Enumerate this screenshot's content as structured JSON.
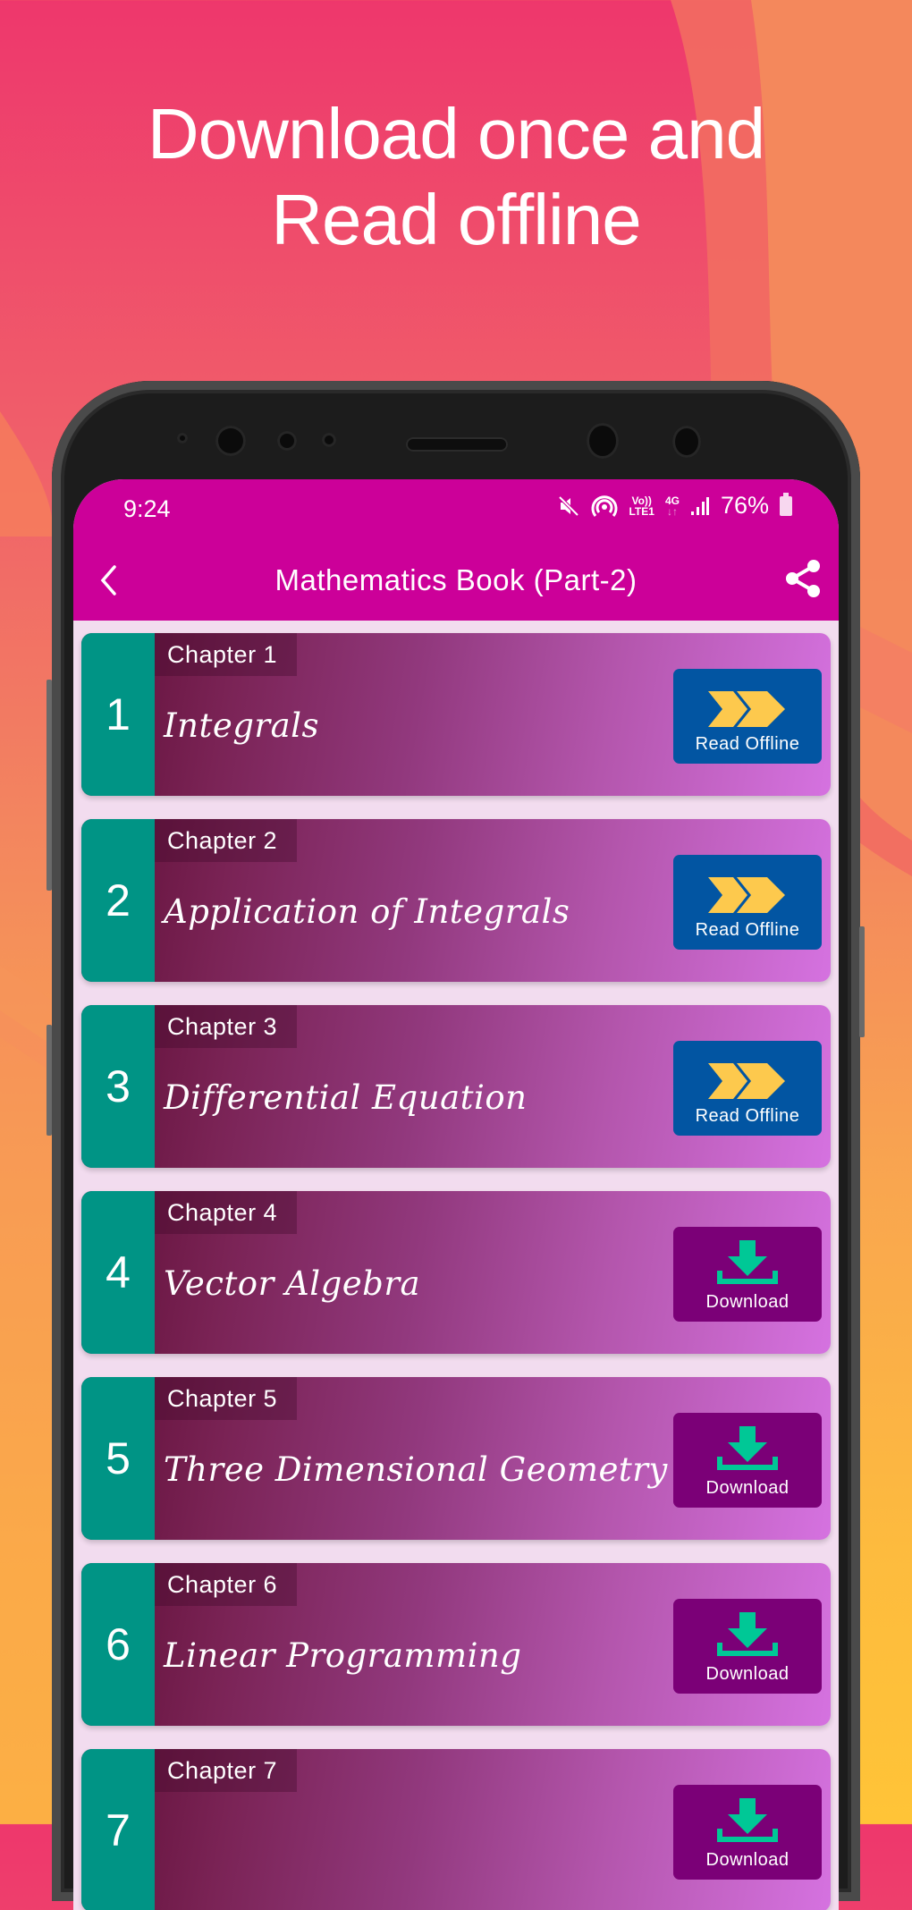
{
  "headline": {
    "line1": "Download once and",
    "line2": "Read offline"
  },
  "status_bar": {
    "time": "9:24",
    "volte": "Vo))",
    "lte": "LTE1",
    "network": "4G",
    "battery": "76%"
  },
  "app_bar": {
    "title": "Mathematics Book (Part-2)",
    "back_icon": "chevron-left-icon",
    "share_icon": "share-icon"
  },
  "colors": {
    "app_bar": "#cc0099",
    "number_badge": "#009485",
    "read_button": "#0255a2",
    "download_button": "#7b0077",
    "read_icon": "#fdc94d",
    "download_icon": "#00c896"
  },
  "chapters": [
    {
      "number": "1",
      "label": "Chapter 1",
      "title": "Integrals",
      "action": "Read Offline",
      "action_type": "read"
    },
    {
      "number": "2",
      "label": "Chapter 2",
      "title": "Application of Integrals",
      "action": "Read Offline",
      "action_type": "read"
    },
    {
      "number": "3",
      "label": "Chapter 3",
      "title": "Differential Equation",
      "action": "Read Offline",
      "action_type": "read"
    },
    {
      "number": "4",
      "label": "Chapter 4",
      "title": "Vector Algebra",
      "action": "Download",
      "action_type": "download"
    },
    {
      "number": "5",
      "label": "Chapter 5",
      "title": "Three Dimensional Geometry",
      "action": "Download",
      "action_type": "download"
    },
    {
      "number": "6",
      "label": "Chapter 6",
      "title": "Linear Programming",
      "action": "Download",
      "action_type": "download"
    },
    {
      "number": "7",
      "label": "Chapter 7",
      "title": "",
      "action": "Download",
      "action_type": "download"
    }
  ]
}
